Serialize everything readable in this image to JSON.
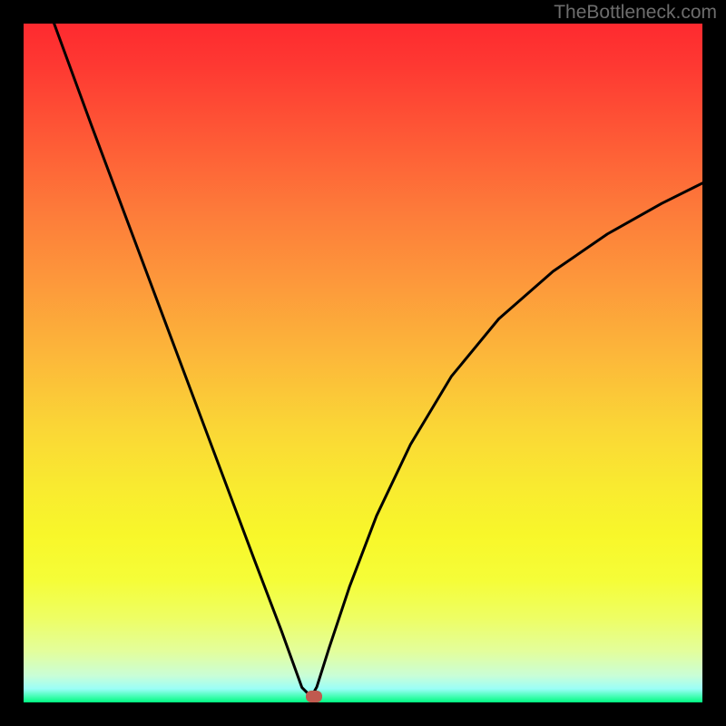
{
  "watermark": "TheBottleneck.com",
  "chart_data": {
    "type": "line",
    "title": "",
    "xlabel": "",
    "ylabel": "",
    "xlim": [
      0,
      100
    ],
    "ylim": [
      0,
      100
    ],
    "notch_x": 42,
    "notch_y": 0,
    "curve_points": [
      {
        "x": 4.5,
        "y": 100
      },
      {
        "x": 10,
        "y": 85
      },
      {
        "x": 16,
        "y": 69
      },
      {
        "x": 22,
        "y": 53
      },
      {
        "x": 28,
        "y": 37
      },
      {
        "x": 34,
        "y": 21
      },
      {
        "x": 38,
        "y": 10.5
      },
      {
        "x": 41,
        "y": 2.2
      },
      {
        "x": 42,
        "y": 1.2
      },
      {
        "x": 42.6,
        "y": 1.2
      },
      {
        "x": 43.2,
        "y": 2.3
      },
      {
        "x": 45,
        "y": 8
      },
      {
        "x": 48,
        "y": 17
      },
      {
        "x": 52,
        "y": 27.5
      },
      {
        "x": 57,
        "y": 38
      },
      {
        "x": 63,
        "y": 48
      },
      {
        "x": 70,
        "y": 56.5
      },
      {
        "x": 78,
        "y": 63.5
      },
      {
        "x": 86,
        "y": 69
      },
      {
        "x": 94,
        "y": 73.5
      },
      {
        "x": 100,
        "y": 76.5
      }
    ],
    "marker": {
      "x": 42.8,
      "y": 1.0,
      "color": "#c05a4f"
    },
    "background_gradient": {
      "top": "#fe2a2f",
      "middle": "#f9ea30",
      "bottom": "#00fc81"
    }
  }
}
